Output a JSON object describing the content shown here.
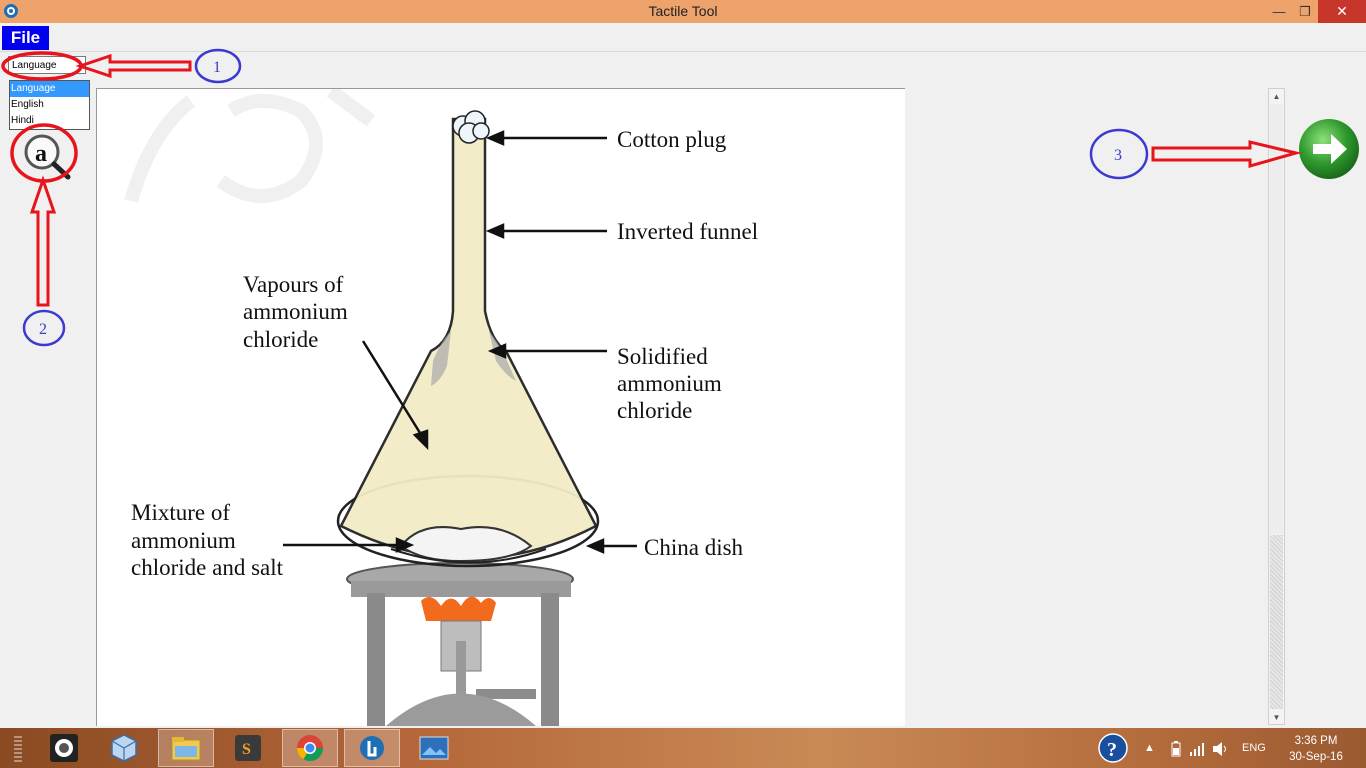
{
  "window": {
    "title": "Tactile Tool",
    "close_glyph": "✕",
    "min_glyph": "—",
    "restore_glyph": "❐"
  },
  "menu": {
    "file": "File"
  },
  "language": {
    "selected": "Language",
    "options": [
      "Language",
      "English",
      "Hindi"
    ]
  },
  "callouts": {
    "one": "1",
    "two": "2",
    "three": "3"
  },
  "diagram": {
    "labels": {
      "cotton_plug": "Cotton plug",
      "inverted_funnel": "Inverted funnel",
      "vapours_1": "Vapours of",
      "vapours_2": "ammonium",
      "vapours_3": "chloride",
      "solidified_1": "Solidified",
      "solidified_2": "ammonium",
      "solidified_3": "chloride",
      "mixture_1": "Mixture of",
      "mixture_2": "ammonium",
      "mixture_3": "chloride and salt",
      "china_dish": "China dish"
    }
  },
  "taskbar": {
    "language_indicator": "ENG",
    "time": "3:36 PM",
    "date": "30-Sep-16",
    "help_glyph": "?"
  },
  "colors": {
    "titlebar": "#eda36b",
    "file_menu": "#0000ee",
    "annotation_red": "#e8141c",
    "annotation_blue": "#3a3ad0",
    "next_green": "#2e9a2e"
  },
  "icons": [
    "app-icon",
    "magnifier-icon",
    "next-arrow-icon",
    "help-icon",
    "chrome-icon",
    "folder-icon"
  ]
}
